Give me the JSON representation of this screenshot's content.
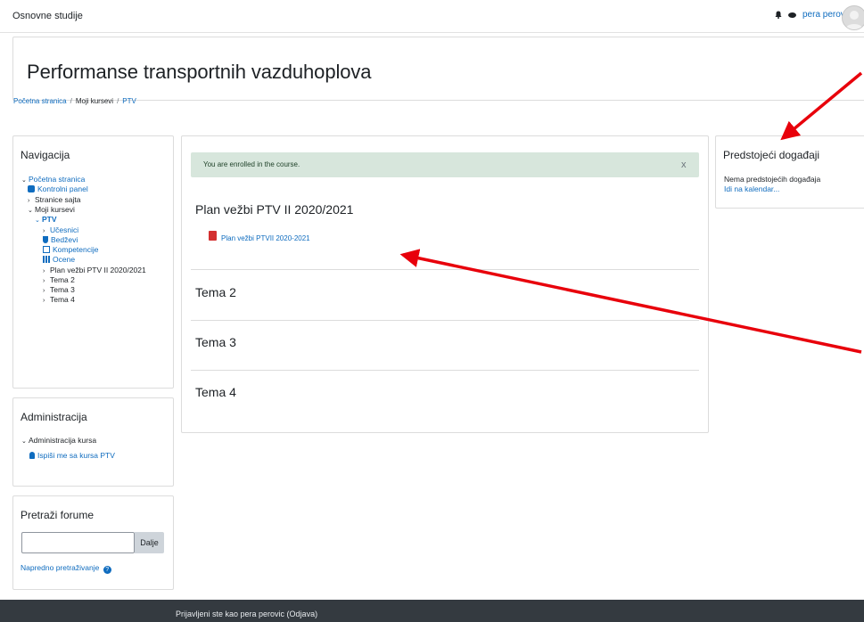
{
  "navbar": {
    "site_name": "Osnovne studije",
    "user_name": "pera perovic"
  },
  "header": {
    "title": "Performanse transportnih vazduhoplova",
    "breadcrumb": [
      "Početna stranica",
      "Moji kursevi",
      "PTV"
    ]
  },
  "navigation": {
    "title": "Navigacija",
    "items": [
      {
        "label": "Početna stranica"
      },
      {
        "label": "Kontrolni panel"
      },
      {
        "label": "Stranice sajta"
      },
      {
        "label": "Moji kursevi"
      },
      {
        "label": "PTV"
      },
      {
        "label": "Učesnici"
      },
      {
        "label": "Bedževi"
      },
      {
        "label": "Kompetencije"
      },
      {
        "label": "Ocene"
      },
      {
        "label": "Plan vežbi PTV II 2020/2021"
      },
      {
        "label": "Tema 2"
      },
      {
        "label": "Tema 3"
      },
      {
        "label": "Tema 4"
      }
    ]
  },
  "administration": {
    "title": "Administracija",
    "section": "Administracija kursa",
    "unenrol": "Ispiši me sa kursa PTV"
  },
  "search_forums": {
    "title": "Pretraži forume",
    "button": "Dalje",
    "advanced": "Napredno pretraživanje"
  },
  "main": {
    "alert": "You are enrolled in the course.",
    "alert_close": "x",
    "sections": [
      {
        "title": "Plan vežbi PTV II 2020/2021",
        "resource": "Plan vežbi PTVII 2020-2021"
      },
      {
        "title": "Tema 2"
      },
      {
        "title": "Tema 3"
      },
      {
        "title": "Tema 4"
      }
    ]
  },
  "events": {
    "title": "Predstojeći događaji",
    "empty": "Nema predstojećih događaja",
    "calendar_link": "Idi na kalendar..."
  },
  "footer": {
    "text": "Prijavljeni ste kao pera perovic (Odjava)"
  },
  "colors": {
    "link": "#0f6cbf",
    "alert_bg": "#d7e6dc",
    "footer_bg": "#343a40",
    "annotation_arrow": "#e8000b"
  }
}
